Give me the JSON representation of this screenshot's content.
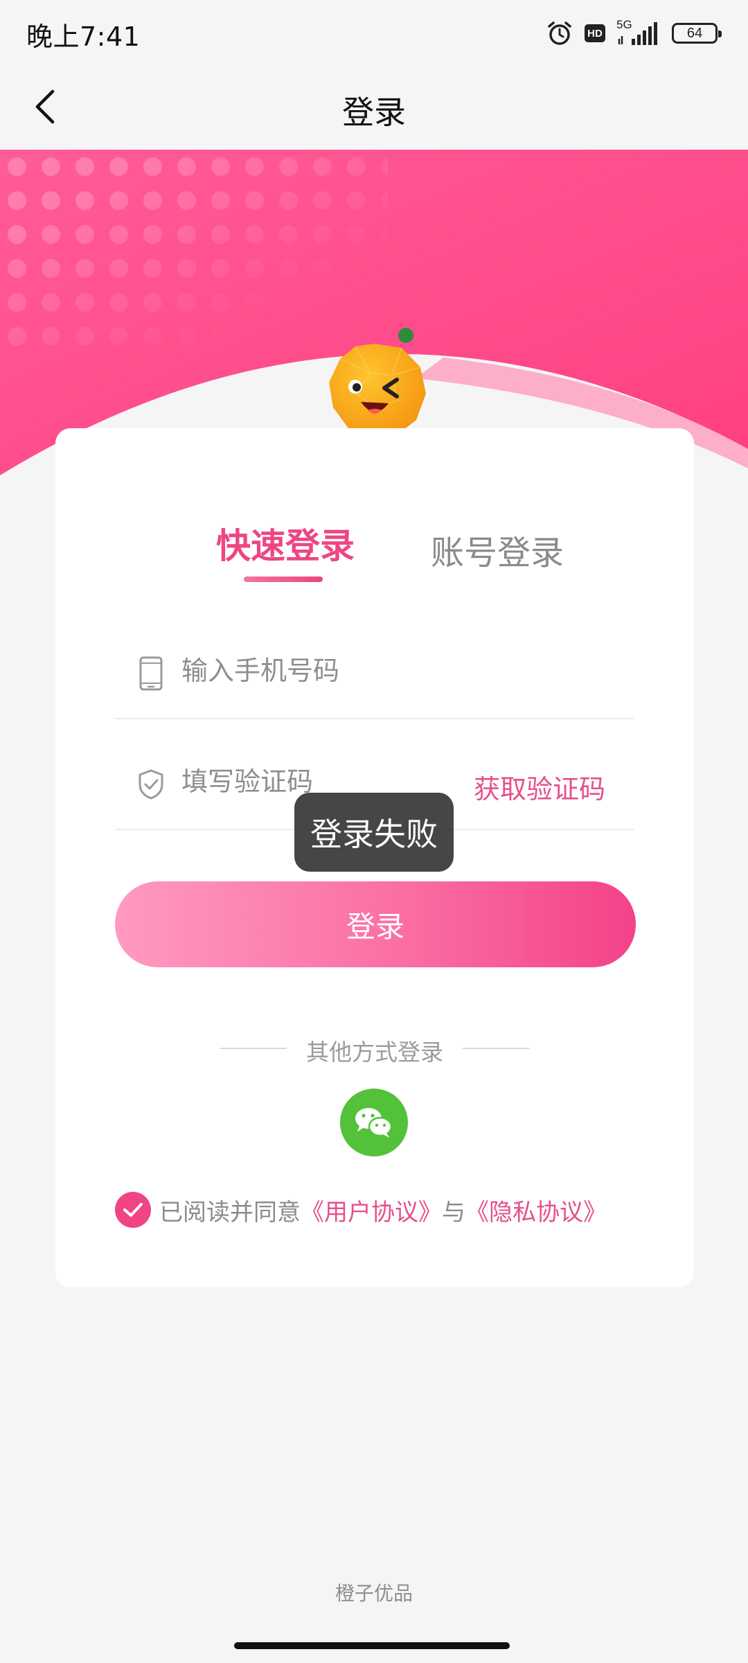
{
  "status_bar": {
    "time": "晚上7:41",
    "hd": "HD",
    "network": "5G",
    "battery": "64"
  },
  "header": {
    "title": "登录"
  },
  "tabs": [
    {
      "label": "快速登录",
      "active": true
    },
    {
      "label": "账号登录",
      "active": false
    }
  ],
  "phone_field": {
    "placeholder": "输入手机号码",
    "value": ""
  },
  "code_field": {
    "placeholder": "填写验证码",
    "value": ""
  },
  "get_code_label": "获取验证码",
  "toast": "登录失败",
  "login_button": "登录",
  "other_login": "其他方式登录",
  "agreement": {
    "prefix": "已阅读并同意",
    "user_agreement": "《用户协议》",
    "and": "与",
    "privacy_policy": "《隐私协议》",
    "checked": true
  },
  "brand": "橙子优品",
  "colors": {
    "accent": "#ee4683",
    "hero": "#ff4d8b",
    "wechat": "#54c13b"
  }
}
